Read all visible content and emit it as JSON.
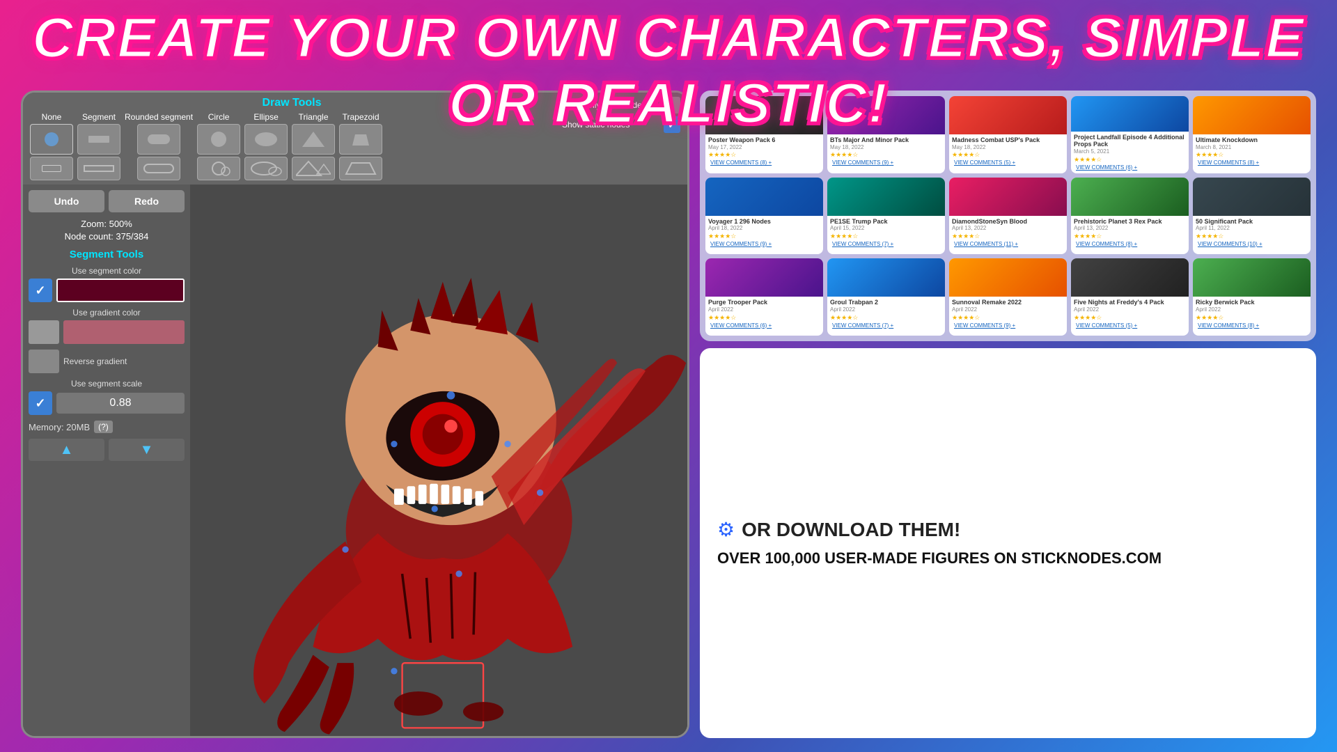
{
  "title": "CREATE YOUR OWN CHARACTERS, SIMPLE OR REALISTIC!",
  "header": {
    "title": "CREATE YOUR OWN CHARACTERS, SIMPLE OR REALISTIC!"
  },
  "app_ui": {
    "undo_label": "Undo",
    "redo_label": "Redo",
    "zoom_text": "Zoom: 500%",
    "node_count": "Node count: 375/384",
    "segment_tools_title": "Segment Tools",
    "use_segment_color": "Use segment color",
    "use_gradient_color": "Use gradient color",
    "reverse_gradient": "Reverse gradient",
    "use_segment_scale": "Use segment scale",
    "scale_value": "0.88",
    "memory": "Memory: 20MB",
    "help": "(?)",
    "show_main_nodes": "Show only main nodes",
    "show_static_nodes": "Show static nodes"
  },
  "draw_tools": {
    "title": "Draw Tools",
    "tools": [
      {
        "label": "None",
        "icon": "none"
      },
      {
        "label": "Segment",
        "icon": "segment"
      },
      {
        "label": "Rounded segment",
        "icon": "rounded-segment"
      },
      {
        "label": "Circle",
        "icon": "circle"
      },
      {
        "label": "Ellipse",
        "icon": "ellipse"
      },
      {
        "label": "Triangle",
        "icon": "triangle"
      },
      {
        "label": "Trapezoid",
        "icon": "trapezoid"
      }
    ]
  },
  "community": {
    "cards": [
      {
        "title": "Poster Weapon Pack 6",
        "meta": "May 17, 2022",
        "stars": "★★★★☆",
        "views": "VIEW COMMENTS (8) +"
      },
      {
        "title": "BTs Major And Minor Pack",
        "meta": "May 18, 2022",
        "stars": "★★★★☆",
        "views": "VIEW COMMENTS (9) +"
      },
      {
        "title": "Madness Combat USP's Pack",
        "meta": "May 18, 2022",
        "stars": "★★★★☆",
        "views": "VIEW COMMENTS (5) +"
      },
      {
        "title": "Project Landfall Episode 4 Additional Props Pack",
        "meta": "March 5, 2021",
        "stars": "★★★★☆",
        "views": "VIEW COMMENTS (6) +"
      },
      {
        "title": "Ultimate Knockdown",
        "meta": "March 8, 2021",
        "stars": "★★★★☆",
        "views": "VIEW COMMENTS (8) +"
      },
      {
        "title": "Voyager 1 296 Nodes",
        "meta": "April 18, 2022",
        "stars": "★★★★☆",
        "views": "VIEW COMMENTS (9) +"
      },
      {
        "title": "PE1SE Trump Pack",
        "meta": "April 15, 2022",
        "stars": "★★★★☆",
        "views": "VIEW COMMENTS (7) +"
      },
      {
        "title": "DiamondStoneSyn Blood",
        "meta": "April 13, 2022",
        "stars": "★★★★☆",
        "views": "VIEW COMMENTS (11) +"
      },
      {
        "title": "Prehistoric Planet 3 Rex Pack",
        "meta": "April 13, 2022",
        "stars": "★★★★☆",
        "views": "VIEW COMMENTS (8) +"
      },
      {
        "title": "50 Significant Pack",
        "meta": "April 11, 2022",
        "stars": "★★★★☆",
        "views": "VIEW COMMENTS (10) +"
      },
      {
        "title": "Purge Trooper Pack",
        "meta": "April 2022",
        "stars": "★★★★☆",
        "views": "VIEW COMMENTS (6) +"
      },
      {
        "title": "Groul Trabpan 2",
        "meta": "April 2022",
        "stars": "★★★★☆",
        "views": "VIEW COMMENTS (7) +"
      },
      {
        "title": "Sunnoval Remake 2022",
        "meta": "April 2022",
        "stars": "★★★★☆",
        "views": "VIEW COMMENTS (9) +"
      },
      {
        "title": "Five Nights at Freddy's 4 Pack",
        "meta": "April 2022",
        "stars": "★★★★☆",
        "views": "VIEW COMMENTS (5) +"
      },
      {
        "title": "Ricky Berwick Pack",
        "meta": "April 2022",
        "stars": "★★★★☆",
        "views": "VIEW COMMENTS (8) +"
      }
    ]
  },
  "download_section": {
    "icon": "⚙",
    "title": "OR DOWNLOAD THEM!",
    "subtitle": "OVER 100,000 USER-MADE FIGURES ON STICKNODES.COM"
  },
  "colors": {
    "cyan_accent": "#00e5ff",
    "dark_red": "#5c0020",
    "pink_color": "#b06070",
    "blue_accent": "#3a7fd5"
  }
}
